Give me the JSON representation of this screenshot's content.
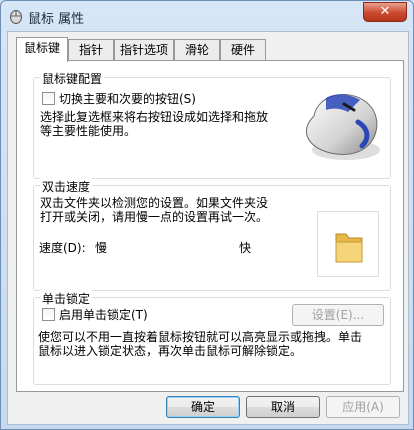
{
  "window": {
    "title": "鼠标 属性",
    "close_label": "✕"
  },
  "tabs": [
    {
      "label": "鼠标键",
      "active": true
    },
    {
      "label": "指针",
      "active": false
    },
    {
      "label": "指针选项",
      "active": false
    },
    {
      "label": "滑轮",
      "active": false
    },
    {
      "label": "硬件",
      "active": false
    }
  ],
  "button_config": {
    "title": "鼠标键配置",
    "switch_label": "切换主要和次要的按钮(S)",
    "switch_checked": false,
    "description": "选择此复选框来将右按钮设成如选择和拖放等主要性能使用。",
    "description_lines": [
      "选择此复选框来将右按钮设成如选择和拖放",
      "等主要性能使用。"
    ],
    "mouse_icon": "mouse-icon"
  },
  "double_click": {
    "title": "双击速度",
    "description_lines": [
      "双击文件夹以检测您的设置。如果文件夹没",
      "打开或关闭，请用慢一点的设置再试一次。"
    ],
    "speed_label": "速度(D):",
    "slow_label": "慢",
    "fast_label": "快",
    "speed_level": 0.5,
    "folder_icon": "folder-icon"
  },
  "click_lock": {
    "title": "单击锁定",
    "enable_label": "启用单击锁定(T)",
    "enable_checked": false,
    "settings_label": "设置(E)...",
    "description_lines": [
      "使您可以不用一直按着鼠标按钮就可以高亮显示或拖拽。单击",
      "鼠标以进入锁定状态，再次单击鼠标可解除锁定。"
    ]
  },
  "footer": {
    "ok_label": "确定",
    "cancel_label": "取消",
    "apply_label": "应用(A)"
  },
  "annotation_color": "#d8141a"
}
